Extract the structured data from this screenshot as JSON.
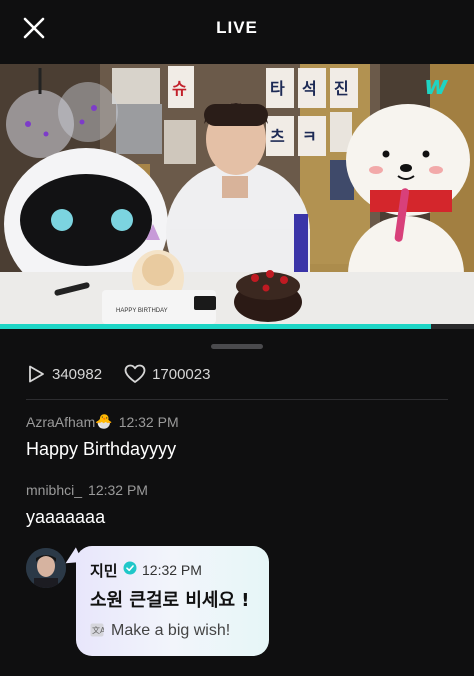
{
  "header": {
    "title": "LIVE",
    "close_icon": "close-icon"
  },
  "video": {
    "poster_letters": [
      "슈",
      "타",
      "석",
      "진",
      "츠",
      "ㅋ"
    ],
    "logo_glyph": "w",
    "cake_topper": "HAPPY\nBIRTHDAY",
    "accent_color": "#1ed6c6",
    "progress_fraction": 0.91
  },
  "stats": {
    "plays": "340982",
    "likes": "1700023",
    "plays_icon": "play-icon",
    "likes_icon": "heart-icon"
  },
  "comments": [
    {
      "user": "AzraAfham",
      "emoji": "🐣",
      "time": "12:32 PM",
      "text": "Happy Birthdayyyy"
    },
    {
      "user": "mnibhci_",
      "time": "12:32 PM",
      "text": "yaaaaaaa"
    }
  ],
  "artist_comment": {
    "name": "지민",
    "verified_icon": "verified-badge-icon",
    "time": "12:32 PM",
    "text": "소원 큰걸로 비세요 !",
    "translation_icon": "translate-icon",
    "translation": "Make a big wish!",
    "bubble_colors": [
      "#e8e6fb",
      "#e6f6f7"
    ]
  }
}
